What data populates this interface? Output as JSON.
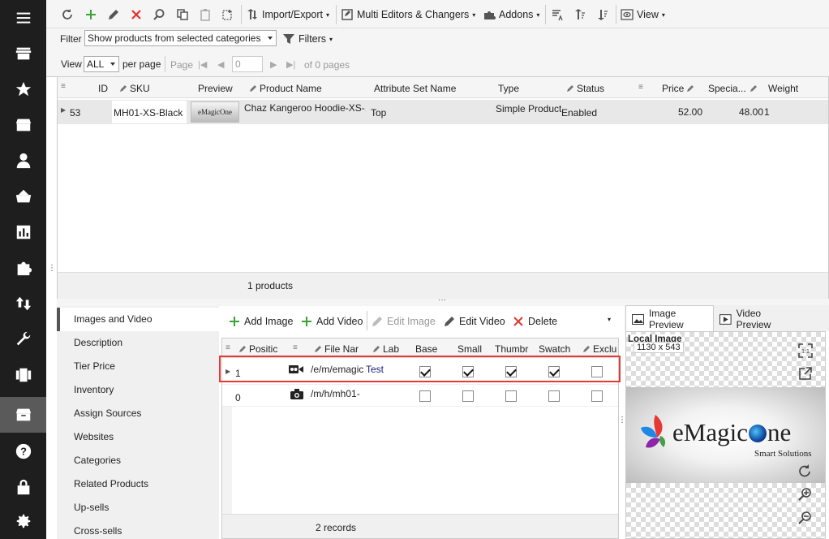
{
  "toolbar": {
    "import_export": "Import/Export",
    "multi_editors": "Multi Editors & Changers",
    "addons": "Addons",
    "view": "View"
  },
  "filter": {
    "label": "Filter",
    "value": "Show products from selected categories",
    "filters_button": "Filters"
  },
  "paging": {
    "view_label": "View",
    "view_value": "ALL",
    "per_page": "per page",
    "page_label": "Page",
    "page_value": "0",
    "of_pages": "of 0 pages"
  },
  "grid": {
    "columns": [
      "ID",
      "SKU",
      "Preview",
      "Product Name",
      "Attribute Set Name",
      "Type",
      "Status",
      "Price",
      "Specia...",
      "Weight"
    ],
    "row": {
      "id": "53",
      "sku": "MH01-XS-Black",
      "preview_logo": "eMagicOne",
      "name": "Chaz Kangeroo Hoodie-XS-...",
      "attribute_set": "Top",
      "type": "Simple Product",
      "status": "Enabled",
      "price": "52.00",
      "special": "48.00",
      "weight": "1"
    },
    "footer": "1 products"
  },
  "tabs": [
    "Images and Video",
    "Description",
    "Tier Price",
    "Inventory",
    "Assign Sources",
    "Websites",
    "Categories",
    "Related Products",
    "Up-sells",
    "Cross-sells"
  ],
  "images_toolbar": {
    "add_image": "Add Image",
    "add_video": "Add Video",
    "edit_image": "Edit Image",
    "edit_video": "Edit Video",
    "delete": "Delete"
  },
  "images_grid": {
    "columns": [
      "Positic",
      "File Nar",
      "Lab",
      "Base",
      "Small",
      "Thumbr",
      "Swatch",
      "Exclu"
    ],
    "rows": [
      {
        "position": "1",
        "file": "/e/m/emagic",
        "label": "Test",
        "type": "video",
        "base": true,
        "small": true,
        "thumb": true,
        "swatch": true,
        "exclude": false
      },
      {
        "position": "0",
        "file": "/m/h/mh01-",
        "label": "",
        "type": "photo",
        "base": false,
        "small": false,
        "thumb": false,
        "swatch": false,
        "exclude": false
      }
    ],
    "footer": "2 records"
  },
  "preview": {
    "tab_image": "Image Preview",
    "tab_video": "Video Preview",
    "local_image": "Local Image",
    "size": "1130 x 543",
    "logo_text": "eMagic",
    "logo_text2": "ne",
    "logo_sub": "Smart Solutions"
  },
  "colors": {
    "nav_bg": "#1e1e1e",
    "highlight": "#e53935",
    "green": "#3aa335",
    "red": "#e0342c"
  }
}
